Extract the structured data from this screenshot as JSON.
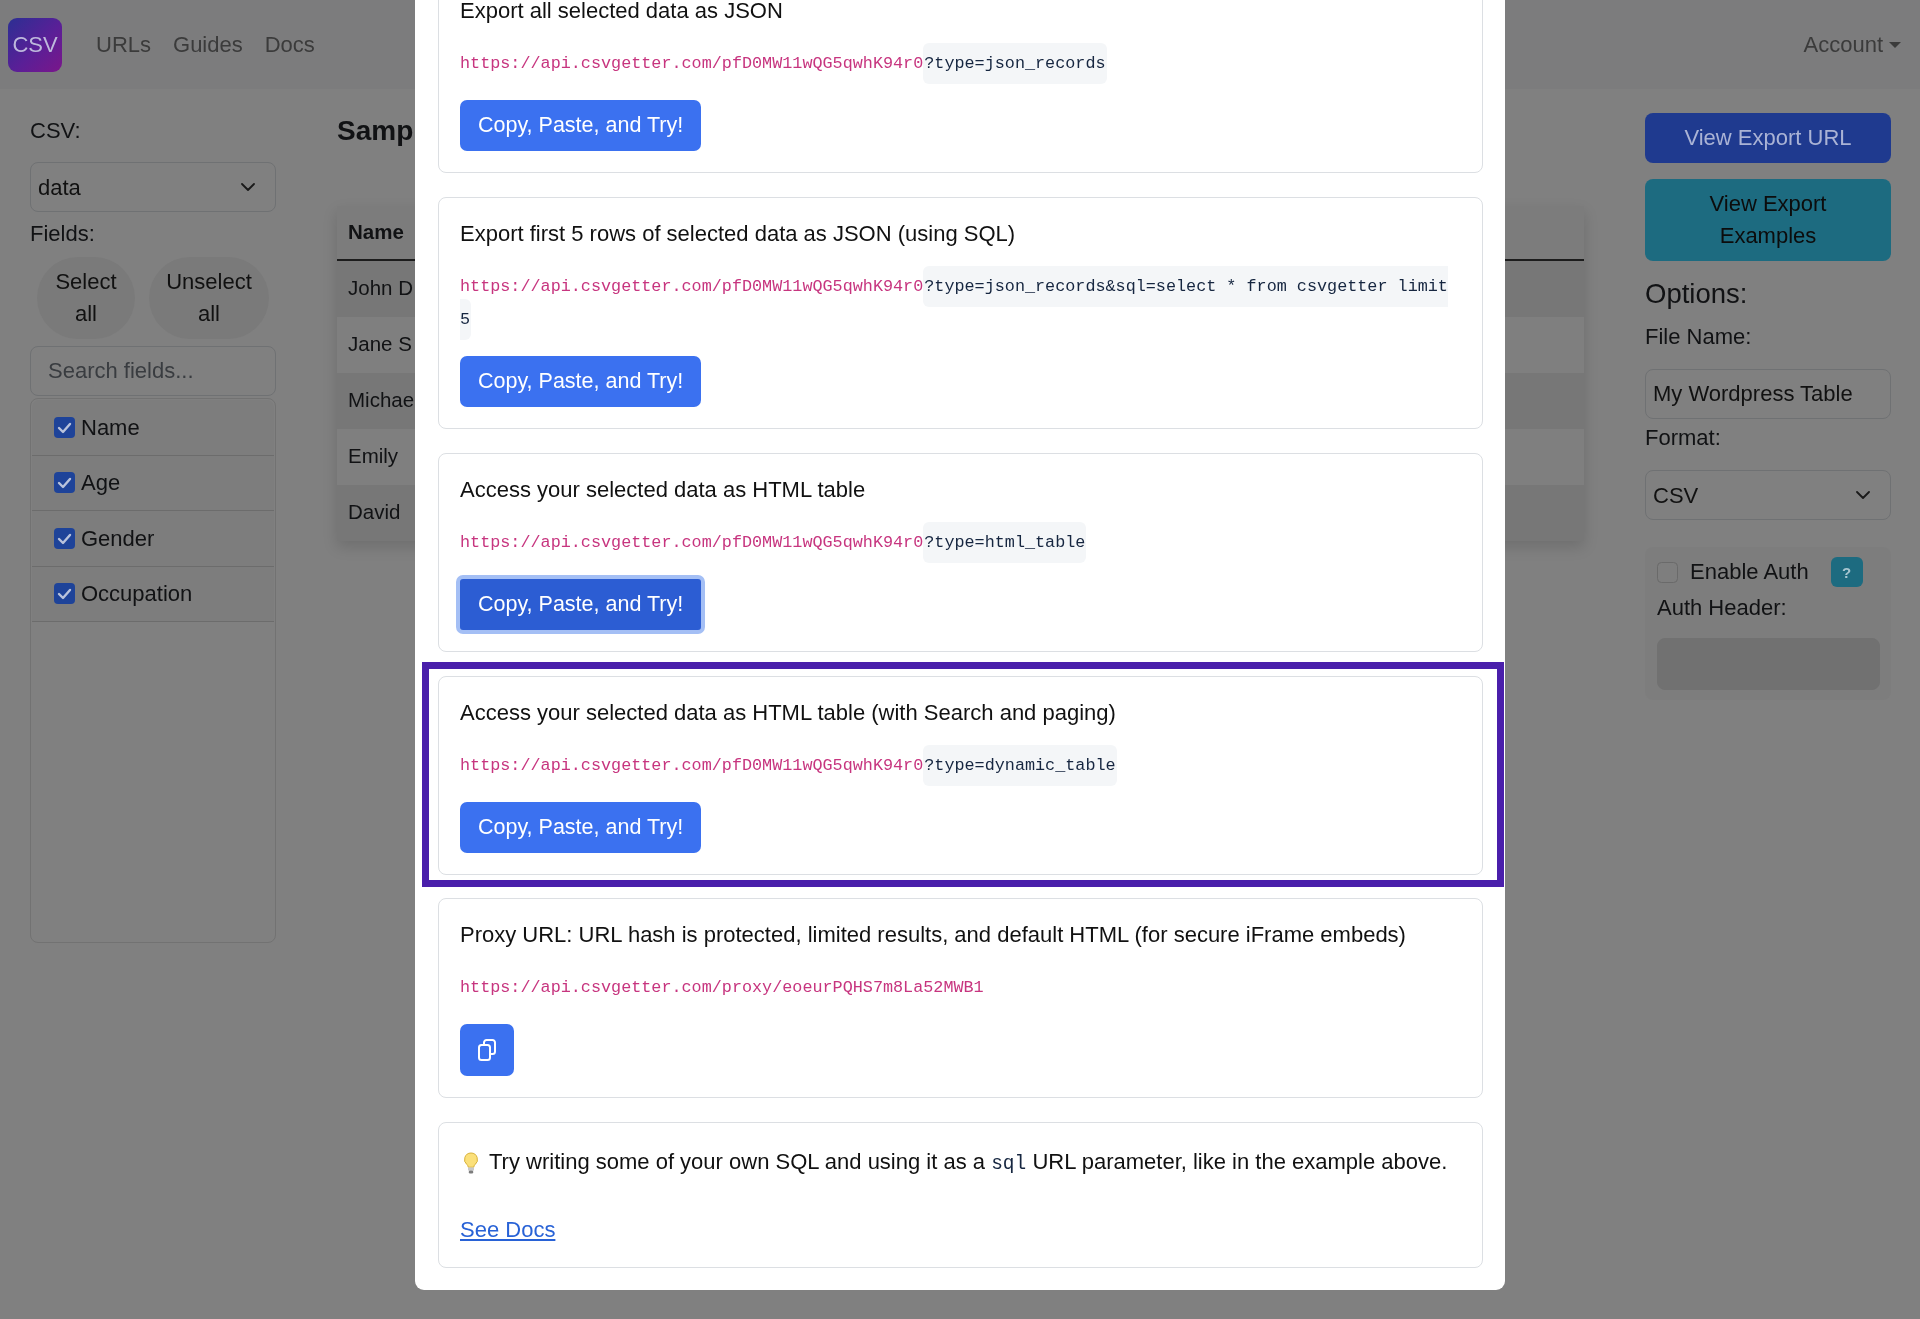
{
  "navbar": {
    "logo": "CSV",
    "links": [
      "URLs",
      "Guides",
      "Docs"
    ],
    "account": "Account"
  },
  "sidebar": {
    "csv_label": "CSV:",
    "csv_select": {
      "value": "data"
    },
    "fields_label": "Fields:",
    "buttons": [
      "Select all",
      "Unselect all"
    ],
    "search": {
      "placeholder": "Search fields..."
    },
    "fields": [
      {
        "label": "Name",
        "checked": true
      },
      {
        "label": "Age",
        "checked": true
      },
      {
        "label": "Gender",
        "checked": true
      },
      {
        "label": "Occupation",
        "checked": true
      }
    ]
  },
  "main": {
    "title": "Samp",
    "table": {
      "columns": [
        "Name"
      ],
      "rows": [
        [
          "John D"
        ],
        [
          "Jane S"
        ],
        [
          "Michae"
        ],
        [
          "Emily"
        ],
        [
          "David"
        ]
      ]
    }
  },
  "options": {
    "buttons": [
      {
        "label": "View Export URL",
        "kind": "primary"
      },
      {
        "label": "View Export Examples",
        "kind": "info"
      }
    ],
    "heading": "Options:",
    "file_name": {
      "label": "File Name:",
      "value": "My Wordpress Table"
    },
    "format": {
      "label": "Format:",
      "value": "CSV"
    },
    "auth": {
      "label": "Enable Auth",
      "checked": false,
      "help": "?",
      "header_label": "Auth Header:",
      "header_disabled": true
    }
  },
  "modal": {
    "cards": [
      {
        "kind": "endpoint",
        "title": "Export all selected data as JSON",
        "url": "https://api.csvgetter.com/pfD0MW11wQG5qwhK94r0",
        "query": "?type=json_records",
        "button": {
          "kind": "text",
          "label": "Copy, Paste, and Try!",
          "focused": false
        },
        "highlighted": false
      },
      {
        "kind": "endpoint",
        "title": "Export first 5 rows of selected data as JSON (using SQL)",
        "url": "https://api.csvgetter.com/pfD0MW11wQG5qwhK94r0",
        "query": "?type=json_records&sql=select * from csvgetter limit 5",
        "button": {
          "kind": "text",
          "label": "Copy, Paste, and Try!",
          "focused": false
        },
        "highlighted": false
      },
      {
        "kind": "endpoint",
        "title": "Access your selected data as HTML table",
        "url": "https://api.csvgetter.com/pfD0MW11wQG5qwhK94r0",
        "query": "?type=html_table",
        "button": {
          "kind": "text",
          "label": "Copy, Paste, and Try!",
          "focused": true
        },
        "highlighted": false
      },
      {
        "kind": "endpoint",
        "title": "Access your selected data as HTML table (with Search and paging)",
        "url": "https://api.csvgetter.com/pfD0MW11wQG5qwhK94r0",
        "query": "?type=dynamic_table",
        "button": {
          "kind": "text",
          "label": "Copy, Paste, and Try!",
          "focused": false
        },
        "highlighted": true
      },
      {
        "kind": "endpoint",
        "title": "Proxy URL: URL hash is protected, limited results, and default HTML (for secure iFrame embeds)",
        "url": "https://api.csvgetter.com/proxy/eoeurPQHS7m8La52MWB1",
        "button": {
          "kind": "icon",
          "focused": false
        },
        "highlighted": false
      },
      {
        "kind": "tip",
        "text_before": "Try writing some of your own SQL and using it as a",
        "code": "sql",
        "text_after": "URL parameter, like in the example above.",
        "link": "See Docs",
        "highlighted": false
      }
    ]
  }
}
